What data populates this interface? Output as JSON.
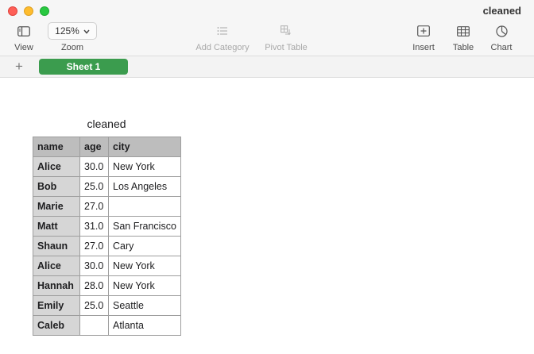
{
  "window": {
    "title": "cleaned"
  },
  "toolbar": {
    "view_label": "View",
    "zoom_label": "Zoom",
    "zoom_value": "125%",
    "add_category_label": "Add Category",
    "pivot_table_label": "Pivot Table",
    "insert_label": "Insert",
    "table_label": "Table",
    "chart_label": "Chart"
  },
  "tabs": {
    "add_symbol": "+",
    "sheet_name": "Sheet 1"
  },
  "table": {
    "title": "cleaned",
    "columns": [
      "name",
      "age",
      "city"
    ],
    "rows": [
      [
        "Alice",
        "30.0",
        "New York"
      ],
      [
        "Bob",
        "25.0",
        "Los Angeles"
      ],
      [
        "Marie",
        "27.0",
        ""
      ],
      [
        "Matt",
        "31.0",
        "San Francisco"
      ],
      [
        "Shaun",
        "27.0",
        "Cary"
      ],
      [
        "Alice",
        "30.0",
        "New York"
      ],
      [
        "Hannah",
        "28.0",
        "New York"
      ],
      [
        "Emily",
        "25.0",
        "Seattle"
      ],
      [
        "Caleb",
        "",
        "Atlanta"
      ]
    ]
  },
  "colors": {
    "sheet_tab": "#3b9c4e",
    "header_row": "#bdbdbd",
    "header_column": "#d6d6d6"
  }
}
